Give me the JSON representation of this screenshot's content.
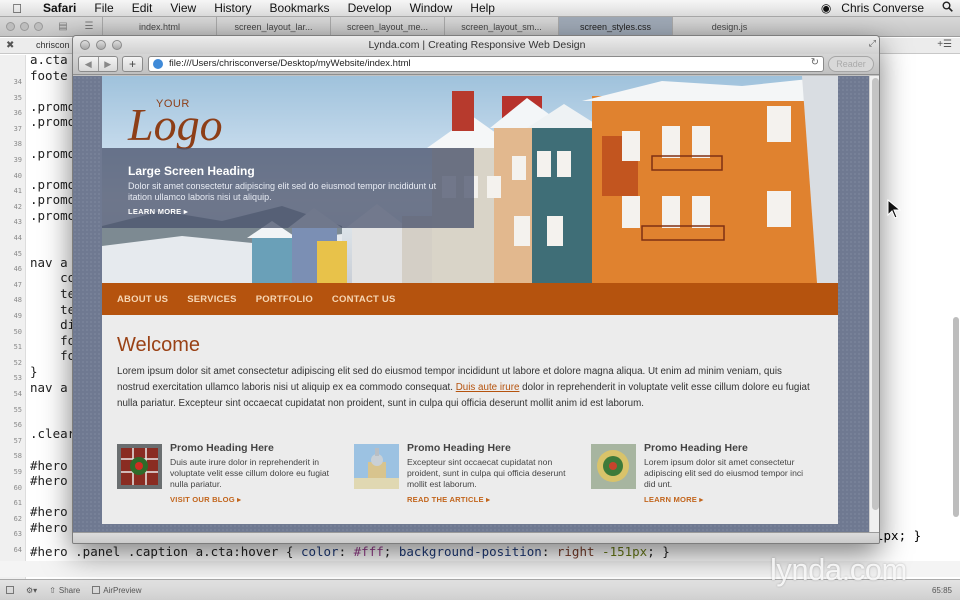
{
  "menubar": {
    "app": "Safari",
    "items": [
      "File",
      "Edit",
      "View",
      "History",
      "Bookmarks",
      "Develop",
      "Window",
      "Help"
    ],
    "user": "Chris Converse"
  },
  "editor": {
    "tabs": [
      "index.html",
      "screen_layout_lar...",
      "screen_layout_me...",
      "screen_layout_sm...",
      "screen_styles.css",
      "design.js"
    ],
    "active_tab_index": 4,
    "breadcrumb": "chriscon",
    "lines": [
      {
        "n": "34",
        "t": "a.cta"
      },
      {
        "n": "35",
        "t": "foote"
      },
      {
        "n": "36",
        "t": ""
      },
      {
        "n": "37",
        "t": ".promo"
      },
      {
        "n": "38",
        "t": ".promo"
      },
      {
        "n": "39",
        "t": ""
      },
      {
        "n": "40",
        "t": ".promo"
      },
      {
        "n": "41",
        "t": ""
      },
      {
        "n": "42",
        "t": ".promo"
      },
      {
        "n": "43",
        "t": ".promo"
      },
      {
        "n": "44",
        "t": ".promo"
      },
      {
        "n": "45",
        "t": ""
      },
      {
        "n": "46",
        "t": ""
      },
      {
        "n": "47",
        "t": "nav a"
      },
      {
        "n": "48",
        "t": "    co"
      },
      {
        "n": "49",
        "t": "    te"
      },
      {
        "n": "50",
        "t": "    te"
      },
      {
        "n": "51",
        "t": "    di"
      },
      {
        "n": "52",
        "t": "    fo"
      },
      {
        "n": "53",
        "t": "    fo"
      },
      {
        "n": "54",
        "t": "}"
      },
      {
        "n": "55",
        "t": "nav a"
      },
      {
        "n": "56",
        "t": ""
      },
      {
        "n": "57",
        "t": ""
      },
      {
        "n": "58",
        "t": ".clear"
      },
      {
        "n": "59",
        "t": ""
      },
      {
        "n": "60",
        "t": "#hero"
      },
      {
        "n": "61",
        "t": "#hero"
      },
      {
        "n": "62",
        "t": ""
      },
      {
        "n": "63",
        "t": "#hero"
      },
      {
        "n": "64",
        "t": "#hero"
      },
      {
        "n": "65",
        "t": ""
      }
    ],
    "line65": {
      "selector": "#hero .panel .caption a.cta:hover { ",
      "prop1": "color",
      "val1": "#fff",
      "prop2": "background-position",
      "val2": "right",
      "num": "-151px",
      "close": "; }"
    },
    "line64_tail": "lpx; }",
    "status": {
      "share": "Share",
      "airpreview": "AirPreview",
      "position": "65:85"
    }
  },
  "safari": {
    "window_title": "Lynda.com | Creating Responsive Web Design",
    "url": "file:///Users/chrisconverse/Desktop/myWebsite/index.html",
    "reader_label": "Reader"
  },
  "site": {
    "logo_small": "YOUR",
    "logo_word": "Logo",
    "hero_heading": "Large Screen Heading",
    "hero_text": "Dolor sit amet consectetur adipiscing elit sed do eiusmod tempor incididunt ut itation ullamco laboris nisi ut aliquip.",
    "hero_cta": "LEARN MORE",
    "nav": [
      "ABOUT US",
      "SERVICES",
      "PORTFOLIO",
      "CONTACT US"
    ],
    "welcome": "Welcome",
    "intro_before": "Lorem ipsum dolor sit amet consectetur adipiscing elit sed do eiusmod tempor incididunt ut labore et dolore magna aliqua. Ut enim ad minim veniam, quis nostrud exercitation ullamco laboris nisi ut aliquip ex ea commodo consequat. ",
    "intro_link": "Duis aute irure",
    "intro_after": " dolor in reprehenderit in voluptate velit esse cillum dolore eu fugiat nulla pariatur. Excepteur sint occaecat cupidatat non proident, sunt in culpa qui officia deserunt mollit anim id est laborum.",
    "promos": [
      {
        "heading": "Promo Heading Here",
        "text": "Duis aute irure dolor in reprehenderit in voluptate velit esse cillum dolore eu fugiat nulla pariatur.",
        "link": "VISIT OUR BLOG"
      },
      {
        "heading": "Promo Heading Here",
        "text": "Excepteur sint occaecat cupidatat non proident, sunt in culpa qui officia deserunt mollit est laborum.",
        "link": "READ THE ARTICLE"
      },
      {
        "heading": "Promo Heading Here",
        "text": "Lorem ipsum dolor sit amet consectetur adipiscing elit sed do eiusmod tempor inci did unt.",
        "link": "LEARN MORE"
      }
    ]
  },
  "watermark": "lynda.com",
  "colors": {
    "accent": "#b5530e",
    "heading": "#9a4216",
    "caption_bg": "#4b556e"
  }
}
